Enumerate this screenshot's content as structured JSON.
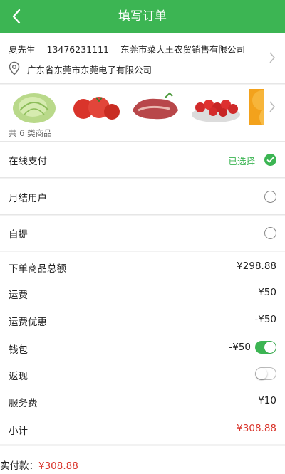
{
  "header": {
    "title": "填写订单",
    "back_icon": "chevron-left-icon"
  },
  "address": {
    "name": "夏先生",
    "phone": "13476231111",
    "company": "东莞市菜大王农贸销售有限公司",
    "detail": "广东省东莞市东莞电子有限公司",
    "pin_icon": "location-pin-icon"
  },
  "goods": {
    "items": [
      "cabbage",
      "tomato",
      "pork",
      "strawberry",
      "orange"
    ],
    "count_text": "共 6 类商品"
  },
  "payment": {
    "options": [
      {
        "label": "在线支付",
        "status": "已选择",
        "selected": true
      },
      {
        "label": "月结用户",
        "selected": false
      },
      {
        "label": "自提",
        "selected": false
      }
    ]
  },
  "summary": {
    "goods_total_label": "下单商品总额",
    "goods_total": "¥298.88",
    "shipping_label": "运费",
    "shipping": "¥50",
    "shipping_discount_label": "运费优惠",
    "shipping_discount": "-¥50",
    "wallet_label": "钱包",
    "wallet": "-¥50",
    "wallet_on": true,
    "cashback_label": "返现",
    "cashback_on": false,
    "service_label": "服务费",
    "service": "¥10",
    "subtotal_label": "小计",
    "subtotal": "¥308.88"
  },
  "footer": {
    "paid_label": "实付款：",
    "paid_amount": "¥308.88"
  },
  "colors": {
    "accent": "#3cb553",
    "price_red": "#d9342b"
  }
}
